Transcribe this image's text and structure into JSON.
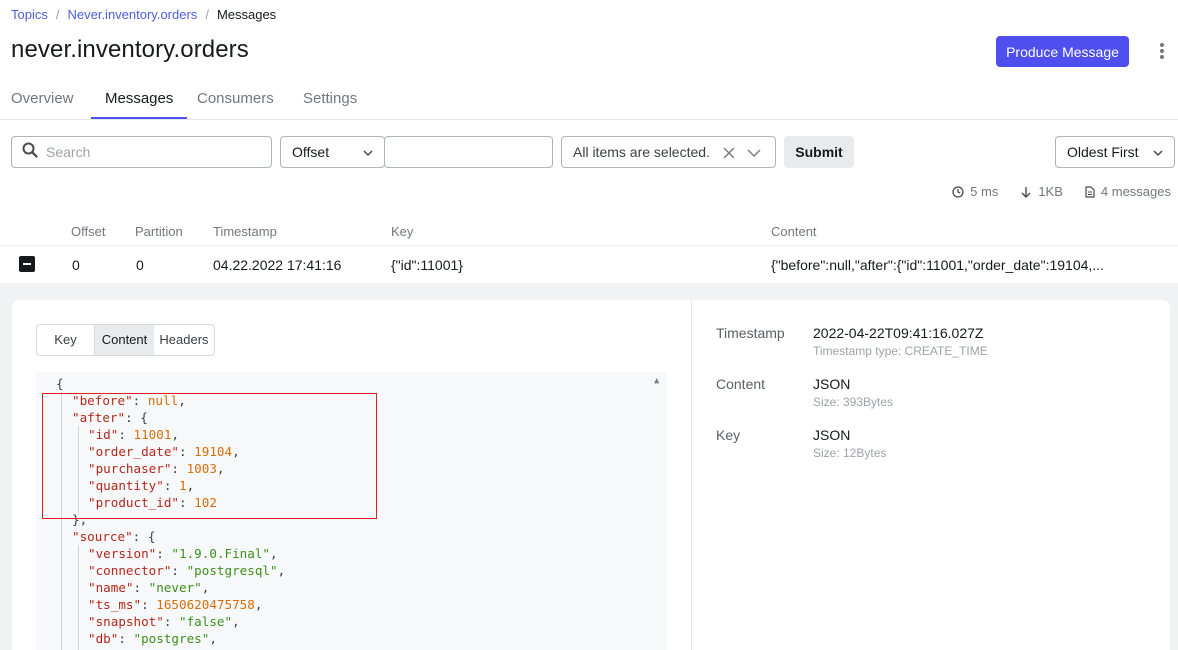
{
  "breadcrumb": {
    "topics": "Topics",
    "topic": "Never.inventory.orders",
    "current": "Messages",
    "sep": "/"
  },
  "page_title": "never.inventory.orders",
  "actions": {
    "produce_label": "Produce Message",
    "more_icon": "more-vertical-icon"
  },
  "tabs": [
    {
      "label": "Overview",
      "active": false
    },
    {
      "label": "Messages",
      "active": true
    },
    {
      "label": "Consumers",
      "active": false
    },
    {
      "label": "Settings",
      "active": false
    }
  ],
  "filters": {
    "search_placeholder": "Search",
    "seek_type": "Offset",
    "offset_value": "",
    "partitions": "All items are selected.",
    "submit_label": "Submit",
    "sort": "Oldest First"
  },
  "stats": {
    "time": "5 ms",
    "size": "1KB",
    "messages": "4 messages"
  },
  "table": {
    "headers": [
      "Offset",
      "Partition",
      "Timestamp",
      "Key",
      "Content"
    ],
    "row": {
      "offset": "0",
      "partition": "0",
      "timestamp": "04.22.2022 17:41:16",
      "key": "{\"id\":11001}",
      "content": "{\"before\":null,\"after\":{\"id\":11001,\"order_date\":19104,..."
    }
  },
  "details": {
    "tabs": [
      "Key",
      "Content",
      "Headers"
    ],
    "active_tab": "Content",
    "json": {
      "open": "{",
      "before_key": "\"before\"",
      "before_val": "null",
      "after_key": "\"after\"",
      "id_key": "\"id\"",
      "id_val": "11001",
      "order_date_key": "\"order_date\"",
      "order_date_val": "19104",
      "purchaser_key": "\"purchaser\"",
      "purchaser_val": "1003",
      "quantity_key": "\"quantity\"",
      "quantity_val": "1",
      "product_id_key": "\"product_id\"",
      "product_id_val": "102",
      "after_close": "},",
      "source_key": "\"source\"",
      "version_key": "\"version\"",
      "version_val": "\"1.9.0.Final\"",
      "connector_key": "\"connector\"",
      "connector_val": "\"postgresql\"",
      "name_key": "\"name\"",
      "name_val": "\"never\"",
      "ts_ms_key": "\"ts_ms\"",
      "ts_ms_val": "1650620475758",
      "snapshot_key": "\"snapshot\"",
      "snapshot_val": "\"false\"",
      "db_key": "\"db\"",
      "db_val": "\"postgres\""
    },
    "meta": {
      "timestamp_label": "Timestamp",
      "timestamp_value": "2022-04-22T09:41:16.027Z",
      "timestamp_type": "Timestamp type: CREATE_TIME",
      "content_label": "Content",
      "content_value": "JSON",
      "content_size": "Size: 393Bytes",
      "key_label": "Key",
      "key_value": "JSON",
      "key_size": "Size: 12Bytes"
    }
  },
  "colors": {
    "accent": "#4f4ff0",
    "json_key": "#b5271d",
    "json_number": "#d96d0b",
    "json_string": "#3d8f1d",
    "highlight": "#e02020"
  }
}
